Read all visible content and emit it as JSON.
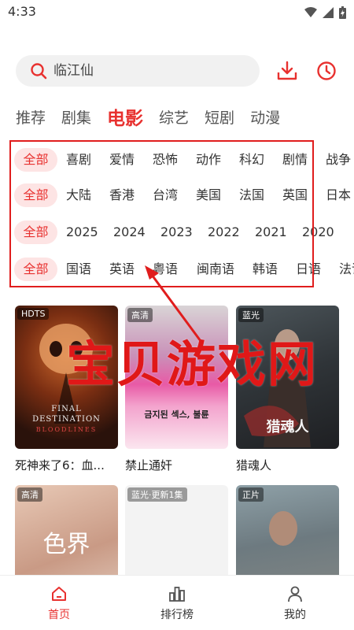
{
  "status_bar": {
    "time": "4:33",
    "icons": [
      "wifi-icon",
      "signal-icon",
      "battery-charging-icon"
    ]
  },
  "search": {
    "placeholder": "临江仙",
    "icon": "search-icon"
  },
  "header_actions": {
    "download_icon": "download-icon",
    "history_icon": "history-clock-icon"
  },
  "tabs": [
    {
      "label": "推荐"
    },
    {
      "label": "剧集"
    },
    {
      "label": "电影",
      "active": true
    },
    {
      "label": "综艺"
    },
    {
      "label": "短剧"
    },
    {
      "label": "动漫"
    }
  ],
  "filters": {
    "genre": {
      "all": "全部",
      "options": [
        "喜剧",
        "爱情",
        "恐怖",
        "动作",
        "科幻",
        "剧情",
        "战争"
      ]
    },
    "region": {
      "all": "全部",
      "options": [
        "大陆",
        "香港",
        "台湾",
        "美国",
        "法国",
        "英国",
        "日本"
      ]
    },
    "year": {
      "all": "全部",
      "options": [
        "2025",
        "2024",
        "2023",
        "2022",
        "2021",
        "2020"
      ]
    },
    "language": {
      "all": "全部",
      "options": [
        "国语",
        "英语",
        "粤语",
        "闽南语",
        "韩语",
        "日语",
        "法语"
      ]
    }
  },
  "movies": [
    {
      "badge": "HDTS",
      "title": "死神来了6：血...",
      "poster_text": [
        "FINAL",
        "DESTINATION",
        "BLOODLINES"
      ]
    },
    {
      "badge": "高清",
      "title": "禁止通奸",
      "poster_text": [
        "금지된 섹스, 불륜"
      ]
    },
    {
      "badge": "蓝光",
      "title": "猎魂人",
      "poster_text": [
        "猎魂人"
      ]
    },
    {
      "badge": "高清",
      "title": "",
      "poster_text": [
        "色界"
      ]
    },
    {
      "badge": "蓝光·更新1集",
      "title": "",
      "poster_text": []
    },
    {
      "badge": "正片",
      "title": "",
      "poster_text": []
    }
  ],
  "watermark": "宝贝游戏网",
  "bottom_nav": [
    {
      "label": "首页",
      "icon": "home-icon",
      "active": true
    },
    {
      "label": "排行榜",
      "icon": "ranking-chart-icon"
    },
    {
      "label": "我的",
      "icon": "profile-icon"
    }
  ],
  "colors": {
    "accent": "#e8312f",
    "chip_bg": "#fde4e4",
    "annotation": "#e01d1d"
  }
}
